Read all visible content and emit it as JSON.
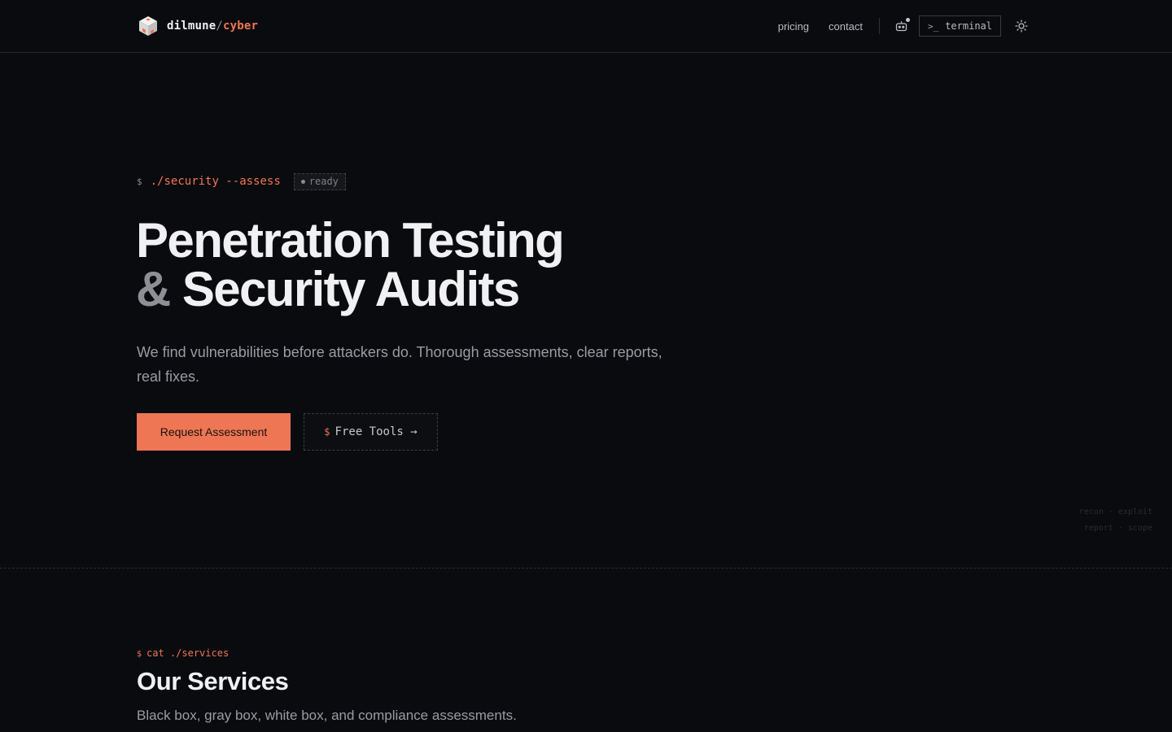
{
  "header": {
    "brand_name": "dilmune",
    "brand_slash": "/",
    "brand_accent": "cyber",
    "nav": [
      {
        "label": "pricing"
      },
      {
        "label": "contact"
      }
    ],
    "terminal_prompt": ">_",
    "terminal_label": "terminal",
    "icons": {
      "assistant": "robot-icon",
      "theme": "sun-icon"
    }
  },
  "hero": {
    "prompt": "$",
    "command": "./security --assess",
    "status": "ready",
    "title_line1": "Penetration Testing",
    "title_amp": "&",
    "title_line2": "Security Audits",
    "subtitle": "We find vulnerabilities before attackers do. Thorough assessments, clear reports, real fixes.",
    "primary_cta": "Request Assessment",
    "secondary_prompt": "$",
    "secondary_cta": "Free Tools →",
    "faint_line1": "recon · exploit",
    "faint_line2": "report · scope"
  },
  "services": {
    "prompt": "$",
    "command": "cat ./services",
    "title": "Our Services",
    "subtitle": "Black box, gray box, white box, and compliance assessments."
  },
  "colors": {
    "background": "#0a0b0e",
    "accent": "#ee7654",
    "text": "#f1f1f3",
    "muted": "#9a9ca3"
  }
}
